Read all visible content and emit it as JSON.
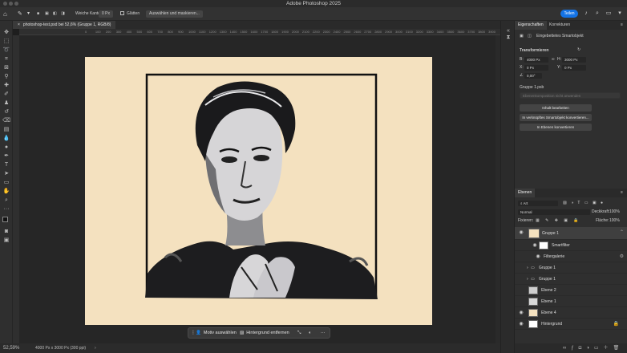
{
  "app": {
    "window_title": "Adobe Photoshop 2025"
  },
  "options_bar": {
    "feather_label": "Weiche Kante:",
    "feather_value": "0 Px",
    "antialias_label": "Glätten",
    "select_mask_button": "Auswählen und maskieren...",
    "share_button": "Teilen"
  },
  "document": {
    "tab_title": "photoshop-test.psd bei 52,6% (Gruppe 1, RGB/8)",
    "ruler_ticks": [
      "0",
      "100",
      "200",
      "300",
      "400",
      "500",
      "600",
      "700",
      "800",
      "900",
      "1000",
      "1100",
      "1200",
      "1300",
      "1400",
      "1500",
      "1600",
      "1700",
      "1800",
      "1900",
      "2000",
      "2100",
      "2200",
      "2300",
      "2400",
      "2500",
      "2600",
      "2700",
      "2800",
      "2900",
      "3000",
      "3100",
      "3200",
      "3300",
      "3400",
      "3500",
      "3600",
      "3700",
      "3800",
      "3900",
      "4000",
      "4100",
      "4200",
      "4300",
      "4400",
      "4500",
      "4600"
    ]
  },
  "context_bar": {
    "select_subject": "Motiv auswählen",
    "remove_background": "Hintergrund entfernen",
    "more": "···"
  },
  "status": {
    "zoom": "52,59%",
    "doc_size": "4000 Px x 3000 Px (300 ppi)"
  },
  "properties": {
    "tab_properties": "Eigenschaften",
    "tab_adjustments": "Korrekturen",
    "object_type": "Eingebettetes Smartobjekt",
    "transform_header": "Transformieren",
    "w_label": "B:",
    "w_value": "4000 Px",
    "h_label": "H:",
    "h_value": "3000 Px",
    "x_label": "X:",
    "x_value": "0 Px",
    "y_label": "Y:",
    "y_value": "0 Px",
    "angle_value": "0,00°",
    "file_label": "Gruppe 1.psb",
    "layer_comp_placeholder": "Ebenenkomposition nicht anwenden",
    "edit_contents": "Inhalt bearbeiten",
    "convert_linked": "In verknüpftes Smartobjekt konvertieren...",
    "convert_layers": "In Ebenen konvertieren"
  },
  "layers_panel": {
    "tab": "Ebenen",
    "filter_kind": "Art",
    "blend_mode": "Normal",
    "opacity_label": "Deckkraft:",
    "opacity_value": "100%",
    "lock_label": "Fixieren:",
    "fill_label": "Fläche:",
    "fill_value": "100%",
    "layers": [
      {
        "name": "Gruppe 1",
        "visible": true,
        "selected": true
      },
      {
        "name": "Smartfilter",
        "visible": true
      },
      {
        "name": "Filtergalerie",
        "visible": true
      },
      {
        "name": "Gruppe 1",
        "visible": false
      },
      {
        "name": "Gruppe 1",
        "visible": false
      },
      {
        "name": "Ebene 2",
        "visible": false
      },
      {
        "name": "Ebene 1",
        "visible": false
      },
      {
        "name": "Ebene 4",
        "visible": true
      },
      {
        "name": "Hintergrund",
        "visible": true
      }
    ]
  },
  "colors": {
    "accent": "#1473e6",
    "canvas_bg": "#f4e1bf",
    "frame": "#111111"
  }
}
